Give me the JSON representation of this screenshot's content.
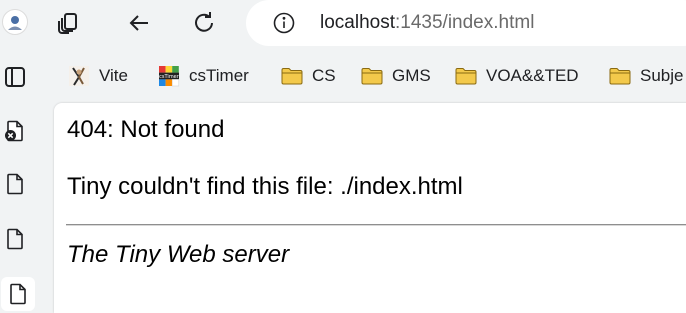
{
  "browser": {
    "url_host": "localhost",
    "url_rest": ":1435/index.html",
    "icons": [
      "profile-icon",
      "tab-actions-icon",
      "back-icon",
      "reload-icon",
      "site-info-icon"
    ]
  },
  "bookmarks": [
    {
      "label": "Vite",
      "icon": "vite-icon"
    },
    {
      "label": "csTimer",
      "icon": "cstimer-icon"
    },
    {
      "label": "CS",
      "icon": "folder-icon"
    },
    {
      "label": "GMS",
      "icon": "folder-icon"
    },
    {
      "label": "VOA&&TED",
      "icon": "folder-icon"
    },
    {
      "label": "Subje",
      "icon": "folder-icon"
    }
  ],
  "sidebar": {
    "icons": [
      "vertical-tabs-icon",
      "page-error-icon",
      "page-icon",
      "page-icon",
      "page-icon"
    ]
  },
  "page": {
    "heading": "404: Not found",
    "message": "Tiny couldn't find this file: ./index.html",
    "signature": "The Tiny Web server"
  },
  "colors": {
    "folder": "#f3c94b",
    "folder_stroke": "#8a6a12",
    "window_bg": "#f1f3f4"
  }
}
